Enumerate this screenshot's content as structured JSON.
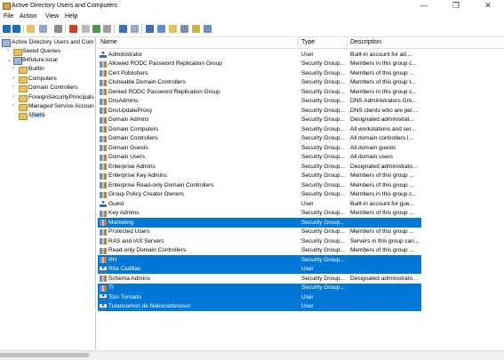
{
  "window": {
    "title": "Active Directory Users and Computers",
    "minimize": "—",
    "maximize": "❐",
    "close": "✕"
  },
  "menu": [
    "File",
    "Action",
    "View",
    "Help"
  ],
  "toolbar": {
    "icons": [
      "back-icon",
      "forward-icon",
      "up-folder-icon",
      "show-tree-icon",
      "copy-icon",
      "cut-icon",
      "delete-icon",
      "properties-icon",
      "refresh-icon",
      "export-icon",
      "help-icon",
      "console-icon",
      "add-user-icon",
      "add-group-icon",
      "add-ou-icon",
      "filter-icon",
      "find-icon",
      "add-to-group-icon"
    ]
  },
  "tree": {
    "root": "Active Directory Users and Com",
    "items": [
      {
        "label": "Saved Queries"
      },
      {
        "label": "B4future.local"
      },
      {
        "label": "Builtin"
      },
      {
        "label": "Computers"
      },
      {
        "label": "Domain Controllers"
      },
      {
        "label": "ForeignSecurityPrincipals"
      },
      {
        "label": "Managed Service Accoun"
      },
      {
        "label": "Users"
      }
    ]
  },
  "columns": {
    "name": "Name",
    "type": "Type",
    "description": "Description"
  },
  "rows": [
    {
      "name": "Administrator",
      "type": "User",
      "desc": "Built-in account for ad...",
      "icon": "user",
      "selected": false
    },
    {
      "name": "Allowed RODC Password Replication Group",
      "type": "Security Group...",
      "desc": "Members in this group c...",
      "icon": "group",
      "selected": false
    },
    {
      "name": "Cert Publishers",
      "type": "Security Group...",
      "desc": "Members of this group ...",
      "icon": "group",
      "selected": false
    },
    {
      "name": "Cloneable Domain Controllers",
      "type": "Security Group...",
      "desc": "Members of this group t...",
      "icon": "group",
      "selected": false
    },
    {
      "name": "Denied RODC Password Replication Group",
      "type": "Security Group...",
      "desc": "Members in this group c...",
      "icon": "group",
      "selected": false
    },
    {
      "name": "DnsAdmins",
      "type": "Security Group...",
      "desc": "DNS Administrators Gro...",
      "icon": "group",
      "selected": false
    },
    {
      "name": "DnsUpdateProxy",
      "type": "Security Group...",
      "desc": "DNS clients who are per...",
      "icon": "group",
      "selected": false
    },
    {
      "name": "Domain Admins",
      "type": "Security Group...",
      "desc": "Designated administrat...",
      "icon": "group",
      "selected": false
    },
    {
      "name": "Domain Computers",
      "type": "Security Group...",
      "desc": "All workstations and ser...",
      "icon": "group",
      "selected": false
    },
    {
      "name": "Domain Controllers",
      "type": "Security Group...",
      "desc": "All domain controllers i...",
      "icon": "group",
      "selected": false
    },
    {
      "name": "Domain Guests",
      "type": "Security Group...",
      "desc": "All domain guests",
      "icon": "group",
      "selected": false
    },
    {
      "name": "Domain Users",
      "type": "Security Group...",
      "desc": "All domain users",
      "icon": "group",
      "selected": false
    },
    {
      "name": "Enterprise Admins",
      "type": "Security Group...",
      "desc": "Designated administrato...",
      "icon": "group",
      "selected": false
    },
    {
      "name": "Enterprise Key Admins",
      "type": "Security Group...",
      "desc": "Members of this group ...",
      "icon": "group",
      "selected": false
    },
    {
      "name": "Enterprise Read-only Domain Controllers",
      "type": "Security Group...",
      "desc": "Members of this group ...",
      "icon": "group",
      "selected": false
    },
    {
      "name": "Group Policy Creator Owners",
      "type": "Security Group...",
      "desc": "Members in this group c...",
      "icon": "group",
      "selected": false
    },
    {
      "name": "Guest",
      "type": "User",
      "desc": "Built-in account for gue...",
      "icon": "user",
      "selected": false
    },
    {
      "name": "Key Admins",
      "type": "Security Group...",
      "desc": "Members of this group ...",
      "icon": "group",
      "selected": false
    },
    {
      "name": "Marketing",
      "type": "Security Group...",
      "desc": "",
      "icon": "group",
      "selected": true
    },
    {
      "name": "Protected Users",
      "type": "Security Group...",
      "desc": "Members of this group ...",
      "icon": "group",
      "selected": false
    },
    {
      "name": "RAS and IAS Servers",
      "type": "Security Group...",
      "desc": "Servers in this group can...",
      "icon": "group",
      "selected": false
    },
    {
      "name": "Read-only Domain Controllers",
      "type": "Security Group...",
      "desc": "Members of this group ...",
      "icon": "group",
      "selected": false
    },
    {
      "name": "RH",
      "type": "Security Group...",
      "desc": "",
      "icon": "group",
      "selected": true
    },
    {
      "name": "Rita Cadillac",
      "type": "User",
      "desc": "",
      "icon": "user",
      "selected": true
    },
    {
      "name": "Schema Admins",
      "type": "Security Group...",
      "desc": "Designated administrato...",
      "icon": "group",
      "selected": false
    },
    {
      "name": "TI",
      "type": "Security Group...",
      "desc": "",
      "icon": "group",
      "selected": true
    },
    {
      "name": "Toni Tornado",
      "type": "User",
      "desc": "",
      "icon": "user",
      "selected": true
    },
    {
      "name": "Tutancamon de Nabucodonosor",
      "type": "User",
      "desc": "",
      "icon": "user",
      "selected": true
    }
  ],
  "colors": {
    "selection": "#0078d7",
    "tree_selection": "#cce4f7"
  }
}
